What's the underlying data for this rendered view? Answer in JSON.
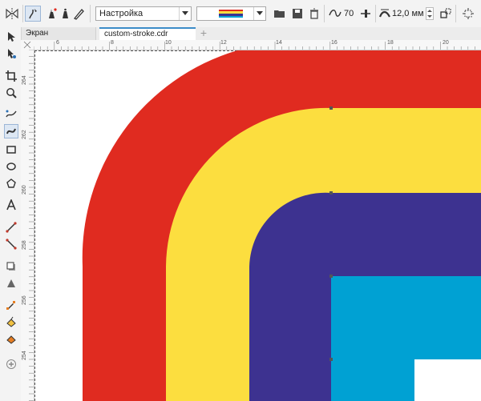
{
  "toolbar": {
    "preset": "Настройка",
    "smoothing": "70",
    "width": "12,0 мм"
  },
  "tabs": {
    "welcome": "Экран приветствия",
    "document": "custom-stroke.cdr",
    "add": "+"
  },
  "ruler": {
    "horizontal": [
      "6",
      "8",
      "10",
      "12",
      "14",
      "16",
      "18",
      "20"
    ],
    "vertical": [
      "264",
      "262",
      "260",
      "258",
      "256",
      "254"
    ]
  },
  "colors": {
    "red": "#e02b20",
    "yellow": "#fcde3f",
    "indigo": "#3d3290",
    "cyan": "#00a1d3"
  }
}
